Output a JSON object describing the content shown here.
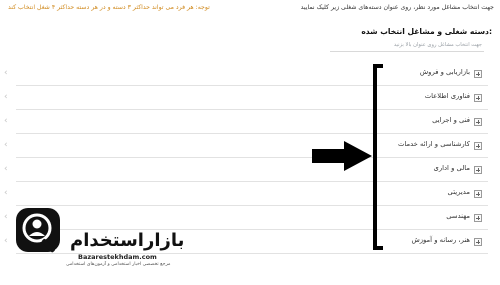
{
  "header": {
    "instruction": "جهت انتخاب مشاغل مورد نظر، روی عنوان دسته‌های شغلی زیر کلیک نمایید",
    "note": "توجه: هر فرد می تواند حداکثر ۳ دسته و در هر دسته حداکثر ۴ شغل انتخاب کند"
  },
  "section": {
    "title": "دسته شغلی و مشاغل انتخاب شده:",
    "hint": "جهت انتخاب مشاغل روی عنوان بالا بزنید"
  },
  "categories": [
    {
      "label": "بازاریابی و فروش"
    },
    {
      "label": "فناوری اطلاعات"
    },
    {
      "label": "فنی و اجرایی"
    },
    {
      "label": "کارشناسی و ارائه خدمات"
    },
    {
      "label": "مالی و اداری"
    },
    {
      "label": "مدیریتی"
    },
    {
      "label": "مهندسی"
    },
    {
      "label": "هنر، رسانه و آموزش"
    }
  ],
  "watermark": {
    "brand": "بازاراستخدام",
    "site": "Bazarestekhdam.com",
    "tagline": "مرجع تخصصی اخبار استخدامی و آزمون‌های استخدامی"
  },
  "colors": {
    "note": "#d08a1e",
    "bracket": "#000000",
    "arrow": "#000000"
  },
  "icons": {
    "expand": "plus-box-icon",
    "collapse": "chevron-left-icon",
    "pointer": "arrow-right-icon",
    "logo": "person-search-icon"
  }
}
